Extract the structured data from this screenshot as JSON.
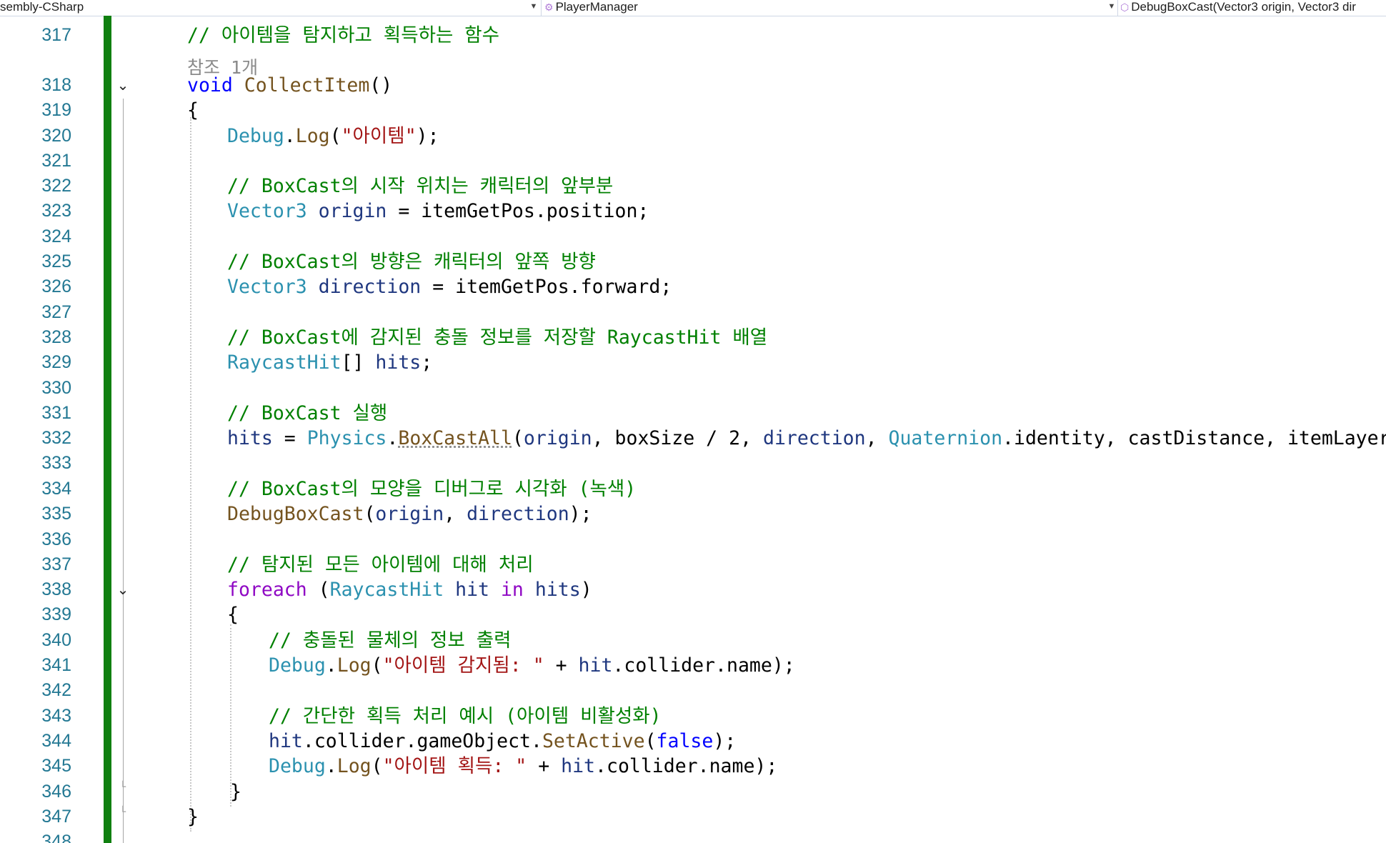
{
  "navbar": {
    "project": "sembly-CSharp",
    "class_name": "PlayerManager",
    "member": "DebugBoxCast(Vector3 origin, Vector3 dir"
  },
  "codelens": "참조 1개",
  "colors": {
    "change_bar": "#108010",
    "line_number": "#237893",
    "comment": "#008000",
    "keyword": "#0000ff",
    "control_keyword": "#8f08c4",
    "type": "#2b91af",
    "method": "#74531f",
    "string": "#a31515",
    "local": "#1f377f"
  },
  "lines": [
    {
      "n": "317",
      "tokens": [
        [
          "// 아이템을 탐지하고 획득하는 함수",
          "comment"
        ]
      ]
    },
    {
      "n": "318",
      "tokens": [
        [
          "void",
          "keyword"
        ],
        [
          " ",
          "plain"
        ],
        [
          "CollectItem",
          "method"
        ],
        [
          "()",
          "plain"
        ]
      ]
    },
    {
      "n": "319",
      "tokens": [
        [
          "{",
          "plain"
        ]
      ]
    },
    {
      "n": "320",
      "tokens": [
        [
          "Debug",
          "type"
        ],
        [
          ".",
          "plain"
        ],
        [
          "Log",
          "method"
        ],
        [
          "(",
          "plain"
        ],
        [
          "\"아이템\"",
          "string"
        ],
        [
          ");",
          "plain"
        ]
      ]
    },
    {
      "n": "321",
      "tokens": []
    },
    {
      "n": "322",
      "tokens": [
        [
          "// BoxCast의 시작 위치는 캐릭터의 앞부분",
          "comment"
        ]
      ]
    },
    {
      "n": "323",
      "tokens": [
        [
          "Vector3",
          "type"
        ],
        [
          " ",
          "plain"
        ],
        [
          "origin",
          "local"
        ],
        [
          " = ",
          "plain"
        ],
        [
          "itemGetPos",
          "field"
        ],
        [
          ".",
          "plain"
        ],
        [
          "position",
          "field"
        ],
        [
          ";",
          "plain"
        ]
      ]
    },
    {
      "n": "324",
      "tokens": []
    },
    {
      "n": "325",
      "tokens": [
        [
          "// BoxCast의 방향은 캐릭터의 앞쪽 방향",
          "comment"
        ]
      ]
    },
    {
      "n": "326",
      "tokens": [
        [
          "Vector3",
          "type"
        ],
        [
          " ",
          "plain"
        ],
        [
          "direction",
          "local"
        ],
        [
          " = ",
          "plain"
        ],
        [
          "itemGetPos",
          "field"
        ],
        [
          ".",
          "plain"
        ],
        [
          "forward",
          "field"
        ],
        [
          ";",
          "plain"
        ]
      ]
    },
    {
      "n": "327",
      "tokens": []
    },
    {
      "n": "328",
      "tokens": [
        [
          "// BoxCast에 감지된 충돌 정보를 저장할 RaycastHit 배열",
          "comment"
        ]
      ]
    },
    {
      "n": "329",
      "tokens": [
        [
          "RaycastHit",
          "type"
        ],
        [
          "[] ",
          "plain"
        ],
        [
          "hits",
          "local"
        ],
        [
          ";",
          "plain"
        ]
      ]
    },
    {
      "n": "330",
      "tokens": []
    },
    {
      "n": "331",
      "tokens": [
        [
          "// BoxCast 실행",
          "comment"
        ]
      ]
    },
    {
      "n": "332",
      "tokens": [
        [
          "hits",
          "local"
        ],
        [
          " = ",
          "plain"
        ],
        [
          "Physics",
          "type"
        ],
        [
          ".",
          "plain"
        ],
        [
          "BoxCastAll",
          "squig"
        ],
        [
          "(",
          "plain"
        ],
        [
          "origin",
          "local"
        ],
        [
          ", ",
          "plain"
        ],
        [
          "boxSize",
          "field"
        ],
        [
          " / ",
          "plain"
        ],
        [
          "2",
          "num"
        ],
        [
          ", ",
          "plain"
        ],
        [
          "direction",
          "local"
        ],
        [
          ", ",
          "plain"
        ],
        [
          "Quaternion",
          "type"
        ],
        [
          ".",
          "plain"
        ],
        [
          "identity",
          "field"
        ],
        [
          ", ",
          "plain"
        ],
        [
          "castDistance",
          "field"
        ],
        [
          ", ",
          "plain"
        ],
        [
          "itemLayer",
          "field"
        ],
        [
          ");",
          "plain"
        ]
      ]
    },
    {
      "n": "333",
      "tokens": []
    },
    {
      "n": "334",
      "tokens": [
        [
          "// BoxCast의 모양을 디버그로 시각화 (녹색)",
          "comment"
        ]
      ]
    },
    {
      "n": "335",
      "tokens": [
        [
          "DebugBoxCast",
          "method"
        ],
        [
          "(",
          "plain"
        ],
        [
          "origin",
          "local"
        ],
        [
          ", ",
          "plain"
        ],
        [
          "direction",
          "local"
        ],
        [
          ");",
          "plain"
        ]
      ]
    },
    {
      "n": "336",
      "tokens": []
    },
    {
      "n": "337",
      "tokens": [
        [
          "// 탐지된 모든 아이템에 대해 처리",
          "comment"
        ]
      ]
    },
    {
      "n": "338",
      "tokens": [
        [
          "foreach",
          "ctrl"
        ],
        [
          " (",
          "plain"
        ],
        [
          "RaycastHit",
          "type"
        ],
        [
          " ",
          "plain"
        ],
        [
          "hit",
          "local"
        ],
        [
          " ",
          "plain"
        ],
        [
          "in",
          "ctrl"
        ],
        [
          " ",
          "plain"
        ],
        [
          "hits",
          "local"
        ],
        [
          ")",
          "plain"
        ]
      ]
    },
    {
      "n": "339",
      "tokens": [
        [
          "{",
          "plain"
        ]
      ]
    },
    {
      "n": "340",
      "tokens": [
        [
          "// 충돌된 물체의 정보 출력",
          "comment"
        ]
      ]
    },
    {
      "n": "341",
      "tokens": [
        [
          "Debug",
          "type"
        ],
        [
          ".",
          "plain"
        ],
        [
          "Log",
          "method"
        ],
        [
          "(",
          "plain"
        ],
        [
          "\"아이템 감지됨: \"",
          "string"
        ],
        [
          " + ",
          "plain"
        ],
        [
          "hit",
          "local"
        ],
        [
          ".",
          "plain"
        ],
        [
          "collider",
          "field"
        ],
        [
          ".",
          "plain"
        ],
        [
          "name",
          "field"
        ],
        [
          ");",
          "plain"
        ]
      ]
    },
    {
      "n": "342",
      "tokens": []
    },
    {
      "n": "343",
      "tokens": [
        [
          "// 간단한 획득 처리 예시 (아이템 비활성화)",
          "comment"
        ]
      ]
    },
    {
      "n": "344",
      "tokens": [
        [
          "hit",
          "local"
        ],
        [
          ".",
          "plain"
        ],
        [
          "collider",
          "field"
        ],
        [
          ".",
          "plain"
        ],
        [
          "gameObject",
          "field"
        ],
        [
          ".",
          "plain"
        ],
        [
          "SetActive",
          "method"
        ],
        [
          "(",
          "plain"
        ],
        [
          "false",
          "keyword"
        ],
        [
          ");",
          "plain"
        ]
      ]
    },
    {
      "n": "345",
      "tokens": [
        [
          "Debug",
          "type"
        ],
        [
          ".",
          "plain"
        ],
        [
          "Log",
          "method"
        ],
        [
          "(",
          "plain"
        ],
        [
          "\"아이템 획득: \"",
          "string"
        ],
        [
          " + ",
          "plain"
        ],
        [
          "hit",
          "local"
        ],
        [
          ".",
          "plain"
        ],
        [
          "collider",
          "field"
        ],
        [
          ".",
          "plain"
        ],
        [
          "name",
          "field"
        ],
        [
          ");",
          "plain"
        ]
      ]
    },
    {
      "n": "346",
      "tokens": [
        [
          "}",
          "plain"
        ]
      ]
    },
    {
      "n": "347",
      "tokens": [
        [
          "}",
          "plain"
        ]
      ]
    },
    {
      "n": "348",
      "tokens": []
    }
  ]
}
